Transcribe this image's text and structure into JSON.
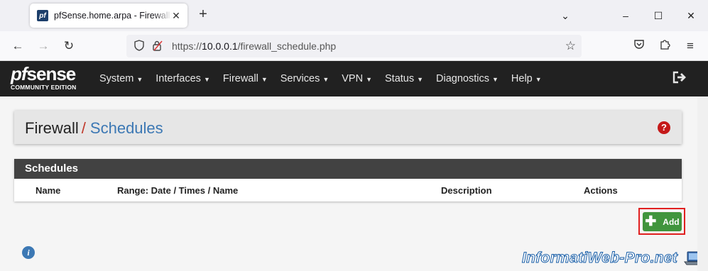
{
  "browser": {
    "tab_title": "pfSense.home.arpa - Firewall: Schedules",
    "tab_favicon_text": "pf",
    "new_tab_symbol": "+",
    "url_prefix": "https://",
    "url_host": "10.0.0.1",
    "url_path": "/firewall_schedule.php"
  },
  "pf": {
    "logo_main": "sense",
    "logo_pf": "pf",
    "logo_sub": "COMMUNITY EDITION",
    "menu": [
      "System",
      "Interfaces",
      "Firewall",
      "Services",
      "VPN",
      "Status",
      "Diagnostics",
      "Help"
    ]
  },
  "breadcrumb": {
    "parent": "Firewall",
    "separator": "/",
    "current": "Schedules"
  },
  "panel": {
    "title": "Schedules",
    "columns": [
      "Name",
      "Range: Date / Times / Name",
      "Description",
      "Actions"
    ]
  },
  "add_button": {
    "label": "Add"
  },
  "watermark": "InformatiWeb-Pro.net",
  "colors": {
    "header_bg": "#212121",
    "breadcrumb_link": "#3c78b4",
    "add_green": "#40953d",
    "highlight_red": "#e02020",
    "help_red": "#c51a1a"
  }
}
